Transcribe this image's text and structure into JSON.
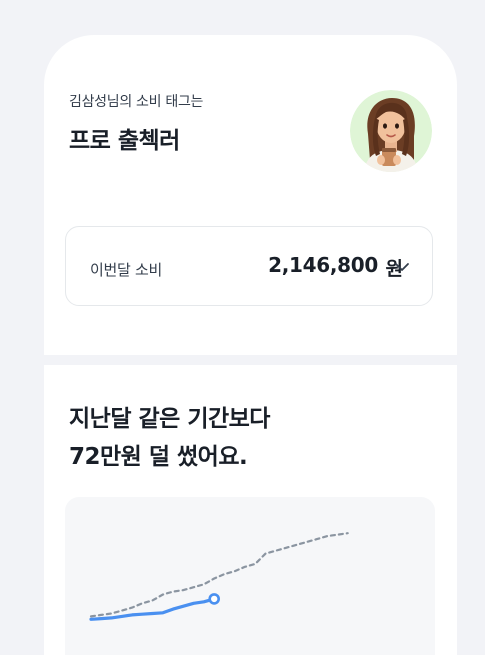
{
  "profile": {
    "subtitle": "김삼성님의 소비 태그는",
    "tag": "프로 출첵러",
    "avatar_icon": "woman-holding-cup-avatar"
  },
  "spending": {
    "label": "이번달 소비",
    "amount": "2,146,800",
    "unit": "원",
    "dropdown_icon": "chevron-down-icon"
  },
  "comparison": {
    "title_line1": "지난달 같은 기간보다",
    "title_line2": "72만원 덜 썼어요."
  },
  "colors": {
    "accent": "#4a90f0",
    "previous_series": "#8b95a1",
    "avatar_bg": "#dff5d6"
  },
  "chart_data": {
    "type": "line",
    "series": [
      {
        "values": [
          2,
          3,
          4,
          6,
          8,
          11,
          13,
          17,
          19,
          20,
          22,
          24,
          28,
          31,
          33,
          36,
          38,
          45,
          47,
          49,
          51,
          53,
          55,
          57,
          58,
          59
        ]
      },
      {
        "values": [
          0,
          0.5,
          1,
          2,
          3,
          3.5,
          4,
          4.5,
          7,
          9,
          11,
          12,
          14
        ]
      }
    ],
    "xlim": [
      1,
      31
    ],
    "ylim": [
      -8,
      66
    ]
  }
}
